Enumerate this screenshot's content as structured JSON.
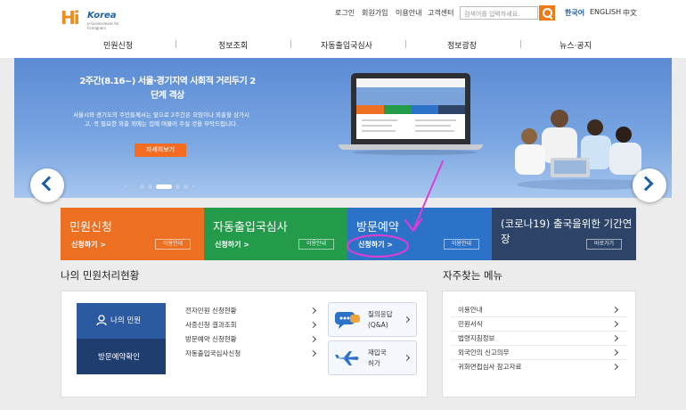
{
  "header": {
    "logo_main": "Hi",
    "logo_korea": "Korea",
    "logo_tagline": "e-Government for Foreigners",
    "util_links": [
      "로그인",
      "회원가입",
      "이용안내",
      "고객센터"
    ],
    "search_placeholder": "검색어를 입력하세요.",
    "languages": [
      "한국어",
      "ENGLISH",
      "中文"
    ],
    "active_language": "한국어"
  },
  "gnb": [
    "민원신청",
    "정보조회",
    "자동출입국심사",
    "정보광장",
    "뉴스·공지"
  ],
  "banner": {
    "title": "2주간(8.16~) 서울·경기지역 사회적 거리두기 2단계 격상",
    "desc": "서울시와 경기도의 주민들께서는 앞으로 2주간은 모임이나 외출을 삼가시고, 꼭 필요한 외출 외에는 집에 머물러 주실 것을 부탁드립니다.",
    "button": "자세히보기",
    "slide_count": 5,
    "active_slide": 3,
    "prev_arrow": "‹",
    "next_arrow": "›"
  },
  "quick": [
    {
      "title": "민원신청",
      "link": "신청하기 >",
      "guide": "이용안내",
      "color": "#ec6f22"
    },
    {
      "title": "자동출입국심사",
      "link": "신청하기 >",
      "guide": "이용안내",
      "color": "#239b4b"
    },
    {
      "title": "방문예약",
      "link": "신청하기 >",
      "guide": "이용안내",
      "color": "#2d72c9"
    },
    {
      "title": "(코로나19) 출국을위한 기간연장",
      "link": "",
      "guide": "바로가기",
      "color": "#2d4468"
    }
  ],
  "status": {
    "title": "나의 민원처리현황",
    "my_button": "나의 민원",
    "visit_button": "방문예약확인",
    "items": [
      "전자민원 신청현황",
      "사증신청 결과조회",
      "방문예약 신청현황",
      "자동출입국심사신청"
    ],
    "cards": [
      {
        "line1": "질의응답",
        "line2": "(Q&A)"
      },
      {
        "line1": "재입국",
        "line2": "허가"
      }
    ]
  },
  "faq": {
    "title": "자주찾는 메뉴",
    "items": [
      "이용안내",
      "민원서식",
      "법령지침정보",
      "외국인의 신고의무",
      "귀화면접심사 참고자료"
    ]
  },
  "annotation_color": "#e23bd3"
}
